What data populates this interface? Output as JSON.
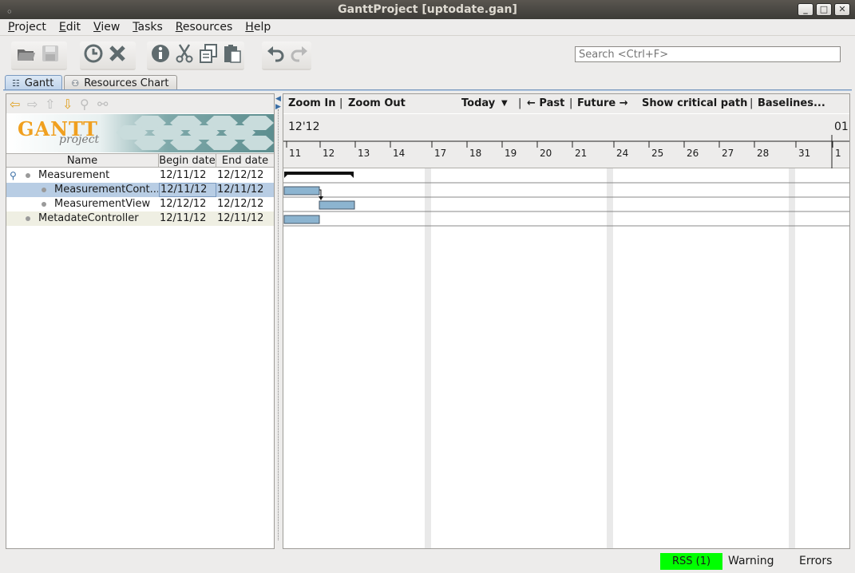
{
  "window": {
    "title": "GanttProject [uptodate.gan]",
    "buttons": [
      "_",
      "□",
      "✕"
    ]
  },
  "menu": {
    "items": [
      {
        "label": "Project",
        "mnemonic": "P",
        "rest": "roject"
      },
      {
        "label": "Edit",
        "mnemonic": "E",
        "rest": "dit"
      },
      {
        "label": "View",
        "mnemonic": "V",
        "rest": "iew"
      },
      {
        "label": "Tasks",
        "mnemonic": "T",
        "rest": "asks"
      },
      {
        "label": "Resources",
        "mnemonic": "R",
        "rest": "esources"
      },
      {
        "label": "Help",
        "mnemonic": "H",
        "rest": "elp"
      }
    ]
  },
  "toolbar": {
    "icons": [
      "open-folder-icon",
      "save-icon",
      "history-icon",
      "delete-icon",
      "info-icon",
      "cut-icon",
      "copy-icon",
      "paste-icon",
      "undo-icon",
      "redo-icon"
    ],
    "search_placeholder": "Search <Ctrl+F>"
  },
  "tabs": [
    {
      "label": "Gantt",
      "active": true
    },
    {
      "label": "Resources Chart",
      "active": false
    }
  ],
  "logo": {
    "main": "GANTT",
    "sub": "project"
  },
  "task_table": {
    "headers": [
      "Name",
      "Begin date",
      "End date"
    ],
    "rows": [
      {
        "name": "Measurement",
        "begin": "12/11/12",
        "end": "12/12/12",
        "level": 0,
        "summary": true
      },
      {
        "name": "MeasurementCont...",
        "begin": "12/11/12",
        "end": "12/11/12",
        "level": 1,
        "selected": true
      },
      {
        "name": "MeasurementView",
        "begin": "12/12/12",
        "end": "12/12/12",
        "level": 1
      },
      {
        "name": "MetadateController",
        "begin": "12/11/12",
        "end": "12/11/12",
        "level": 0
      }
    ]
  },
  "chart_toolbar": {
    "zoom_in": "Zoom In",
    "zoom_out": "Zoom Out",
    "today": "Today",
    "past": "← Past",
    "future": "Future →",
    "critical": "Show critical path",
    "baselines": "Baselines..."
  },
  "timeline": {
    "year_left": "12'12",
    "year_right": "01",
    "days": [
      "11",
      "12",
      "13",
      "14",
      "17",
      "18",
      "19",
      "20",
      "21",
      "24",
      "25",
      "26",
      "27",
      "28",
      "31",
      "1"
    ]
  },
  "statusbar": {
    "rss": "RSS (1)",
    "warning": "Warning",
    "errors": "Errors",
    "rss_color": "#00ff00"
  },
  "colors": {
    "task_bar": "#8cb4d0",
    "selected_row": "#b8cde4",
    "weekend": "#e9e9e9"
  }
}
